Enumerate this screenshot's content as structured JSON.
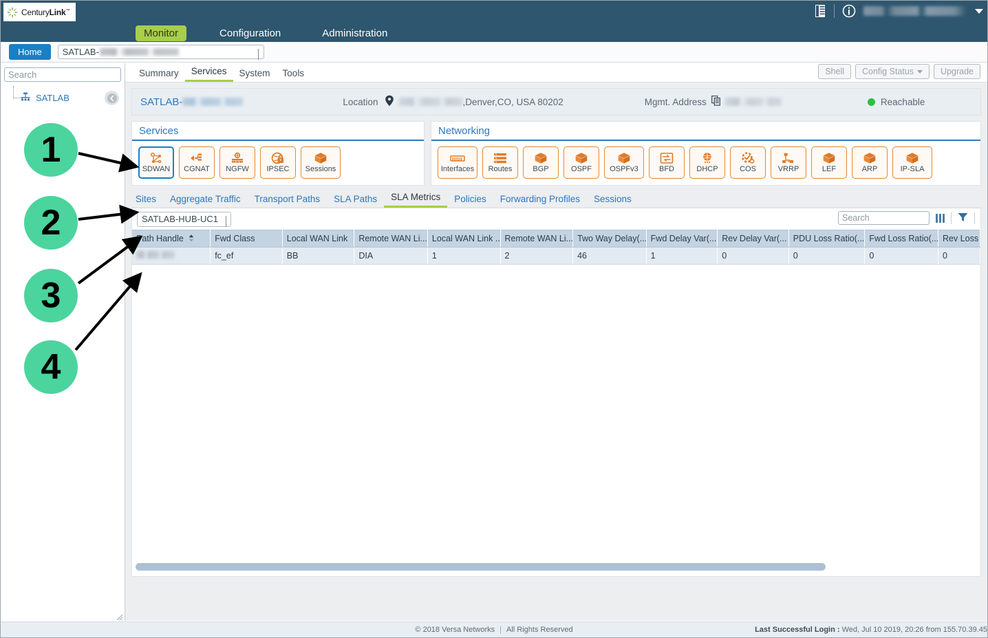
{
  "brand": {
    "name_light": "Century",
    "name_bold": "Link",
    "tm": "™"
  },
  "topnav": {
    "items": [
      {
        "label": "Monitor",
        "active": true
      },
      {
        "label": "Configuration",
        "active": false
      },
      {
        "label": "Administration",
        "active": false
      }
    ],
    "report_icon": "report-icon",
    "info_icon": "info-icon",
    "user_menu": "user-menu"
  },
  "homebar": {
    "home_label": "Home",
    "device_prefix": "SATLAB-"
  },
  "sidebar": {
    "search_placeholder": "Search",
    "tree_root": "SATLAB",
    "collapse_icon": "collapse-left-icon"
  },
  "content_tabs": [
    {
      "label": "Summary",
      "active": false
    },
    {
      "label": "Services",
      "active": true
    },
    {
      "label": "System",
      "active": false
    },
    {
      "label": "Tools",
      "active": false
    }
  ],
  "actions": {
    "shell": "Shell",
    "config_status": "Config Status",
    "upgrade": "Upgrade"
  },
  "devicebar": {
    "name_prefix": "SATLAB-",
    "location_label": "Location",
    "location_value": ",Denver,CO, USA 80202",
    "mgmt_label": "Mgmt. Address",
    "status": "Reachable",
    "status_color": "#28c142"
  },
  "services_panel": {
    "title": "Services",
    "buttons": [
      {
        "label": "SDWAN",
        "icon": "sdwan-icon",
        "selected": true
      },
      {
        "label": "CGNAT",
        "icon": "cgnat-icon",
        "selected": false
      },
      {
        "label": "NGFW",
        "icon": "ngfw-icon",
        "selected": false
      },
      {
        "label": "IPSEC",
        "icon": "ipsec-icon",
        "selected": false
      },
      {
        "label": "Sessions",
        "icon": "sessions-icon",
        "selected": false
      }
    ]
  },
  "networking_panel": {
    "title": "Networking",
    "buttons": [
      {
        "label": "Interfaces",
        "icon": "interfaces-icon"
      },
      {
        "label": "Routes",
        "icon": "routes-icon"
      },
      {
        "label": "BGP",
        "icon": "cube-icon"
      },
      {
        "label": "OSPF",
        "icon": "cube-icon"
      },
      {
        "label": "OSPFv3",
        "icon": "cube-icon"
      },
      {
        "label": "BFD",
        "icon": "bfd-icon"
      },
      {
        "label": "DHCP",
        "icon": "dhcp-icon"
      },
      {
        "label": "COS",
        "icon": "cos-icon"
      },
      {
        "label": "VRRP",
        "icon": "vrrp-icon"
      },
      {
        "label": "LEF",
        "icon": "cube-icon"
      },
      {
        "label": "ARP",
        "icon": "cube-icon"
      },
      {
        "label": "IP-SLA",
        "icon": "cube-icon"
      }
    ]
  },
  "subtabs": [
    {
      "label": "Sites",
      "active": false
    },
    {
      "label": "Aggregate Traffic",
      "active": false
    },
    {
      "label": "Transport Paths",
      "active": false
    },
    {
      "label": "SLA Paths",
      "active": false
    },
    {
      "label": "SLA Metrics",
      "active": true
    },
    {
      "label": "Policies",
      "active": false
    },
    {
      "label": "Forwarding Profiles",
      "active": false
    },
    {
      "label": "Sessions",
      "active": false
    }
  ],
  "table_toolbar": {
    "site_selected": "SATLAB-HUB-UC1",
    "search_placeholder": "Search",
    "columns_icon": "columns-icon",
    "filter_icon": "filter-funnel-icon"
  },
  "table": {
    "columns": [
      "Path Handle",
      "Fwd Class",
      "Local WAN Link",
      "Remote WAN Li...",
      "Local WAN Link ...",
      "Remote WAN Li...",
      "Two Way Delay(...",
      "Fwd Delay Var(...",
      "Rev Delay Var(...",
      "PDU Loss Ratio(...",
      "Fwd Loss Ratio(...",
      "Rev Loss"
    ],
    "sorted_column_index": 0,
    "rows": [
      {
        "path_handle": "",
        "fwd_class": "fc_ef",
        "local_wan_link": "BB",
        "remote_wan_link": "DIA",
        "local_wan_link_2": "1",
        "remote_wan_link_2": "2",
        "two_way_delay": "46",
        "fwd_delay_var": "1",
        "rev_delay_var": "0",
        "pdu_loss_ratio": "0",
        "fwd_loss_ratio": "0",
        "rev_loss": "0"
      }
    ]
  },
  "footer": {
    "copyright": "© 2018 Versa Networks",
    "separator": "|",
    "rights": "All Rights Reserved",
    "login_label": "Last Successful Login :",
    "login_value": "Wed, Jul 10 2019, 20:26 from 155.70.39.45"
  },
  "annotations": [
    {
      "number": "1"
    },
    {
      "number": "2"
    },
    {
      "number": "3"
    },
    {
      "number": "4"
    }
  ]
}
